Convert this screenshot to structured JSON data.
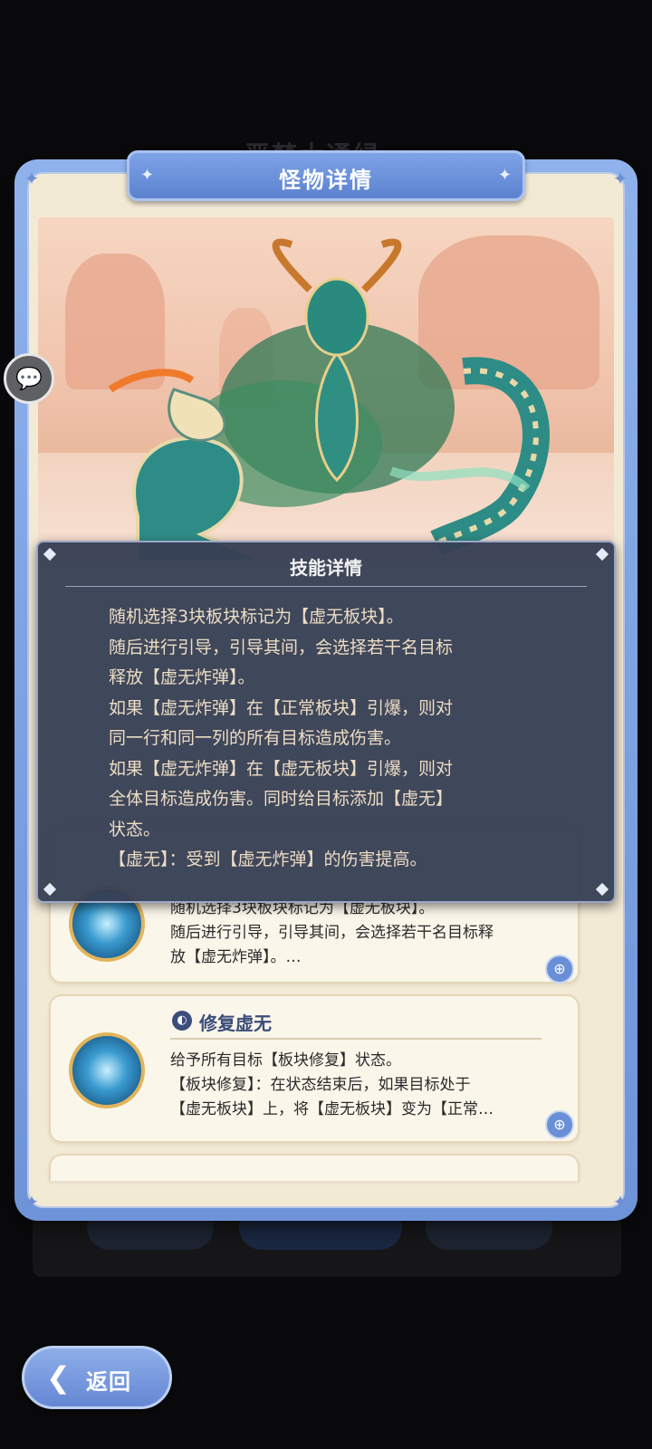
{
  "background": {
    "faded_title": "恶梦大通绿"
  },
  "modal": {
    "title": "怪物详情"
  },
  "tooltip": {
    "title": "技能详情",
    "lines": [
      "随机选择3块板块标记为【虚无板块】。",
      "随后进行引导，引导其间，会选择若干名目标",
      "释放【虚无炸弹】。",
      "如果【虚无炸弹】在【正常板块】引爆，则对",
      "同一行和同一列的所有目标造成伤害。",
      "如果【虚无炸弹】在【虚无板块】引爆，则对",
      "全体目标造成伤害。同时给目标添加【虚无】",
      "状态。",
      "【虚无】：受到【虚无炸弹】的伤害提高。"
    ]
  },
  "skills": [
    {
      "name": "",
      "desc": [
        "随机选择3块板块标记为【虚无板块】。",
        "随后进行引导，引导其间，会选择若干名目标释",
        "放【虚无炸弹】。…"
      ]
    },
    {
      "name": "修复虚无",
      "desc": [
        "给予所有目标【板块修复】状态。",
        "【板块修复】：在状态结束后，如果目标处于",
        "【虚无板块】上，将【虚无板块】变为【正常…"
      ]
    }
  ],
  "back_button": {
    "label": "返回"
  },
  "icons": {
    "chat": "chat-bubble-icon",
    "zoom": "zoom-in-icon",
    "back": "back-arrow-icon"
  },
  "colors": {
    "frame_blue": "#6e93d8",
    "panel_cream": "#f3ead6",
    "tooltip_bg": "#373f54",
    "tooltip_text": "#ecdcc4"
  }
}
